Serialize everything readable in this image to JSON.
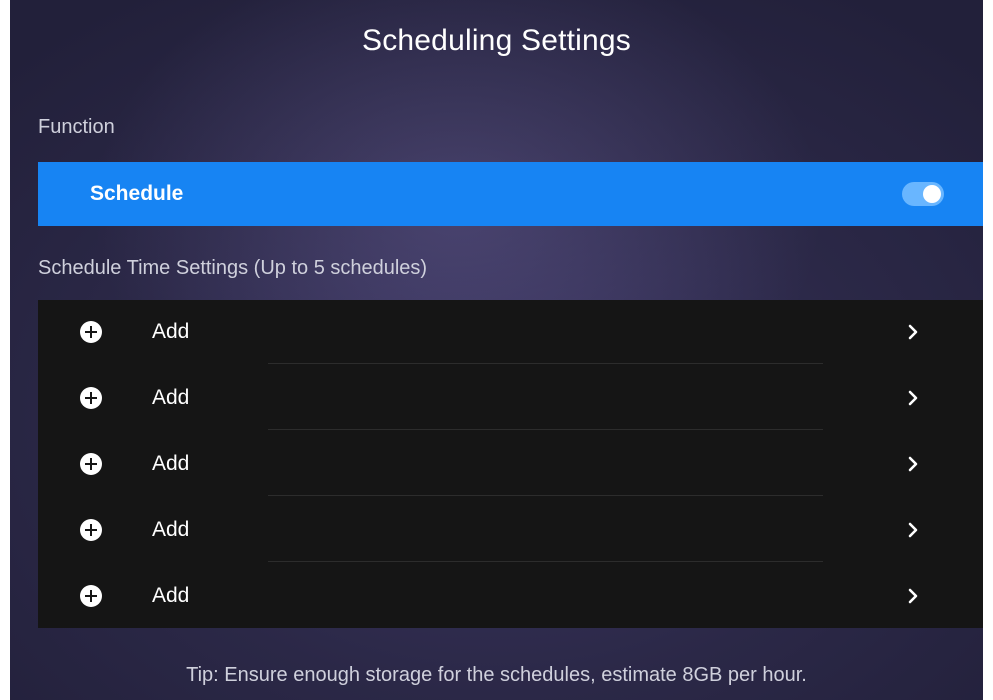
{
  "header": {
    "title": "Scheduling Settings"
  },
  "function_section": {
    "label": "Function",
    "schedule_label": "Schedule",
    "schedule_enabled": true,
    "accent_color": "#1784f3"
  },
  "schedule_time_section": {
    "label": "Schedule Time Settings (Up to 5 schedules)",
    "items": [
      {
        "label": "Add",
        "icon": "plus-circle-icon",
        "chevron": "chevron-right-icon"
      },
      {
        "label": "Add",
        "icon": "plus-circle-icon",
        "chevron": "chevron-right-icon"
      },
      {
        "label": "Add",
        "icon": "plus-circle-icon",
        "chevron": "chevron-right-icon"
      },
      {
        "label": "Add",
        "icon": "plus-circle-icon",
        "chevron": "chevron-right-icon"
      },
      {
        "label": "Add",
        "icon": "plus-circle-icon",
        "chevron": "chevron-right-icon"
      }
    ]
  },
  "footer": {
    "tip": "Tip: Ensure enough storage for the schedules, estimate 8GB per hour."
  }
}
